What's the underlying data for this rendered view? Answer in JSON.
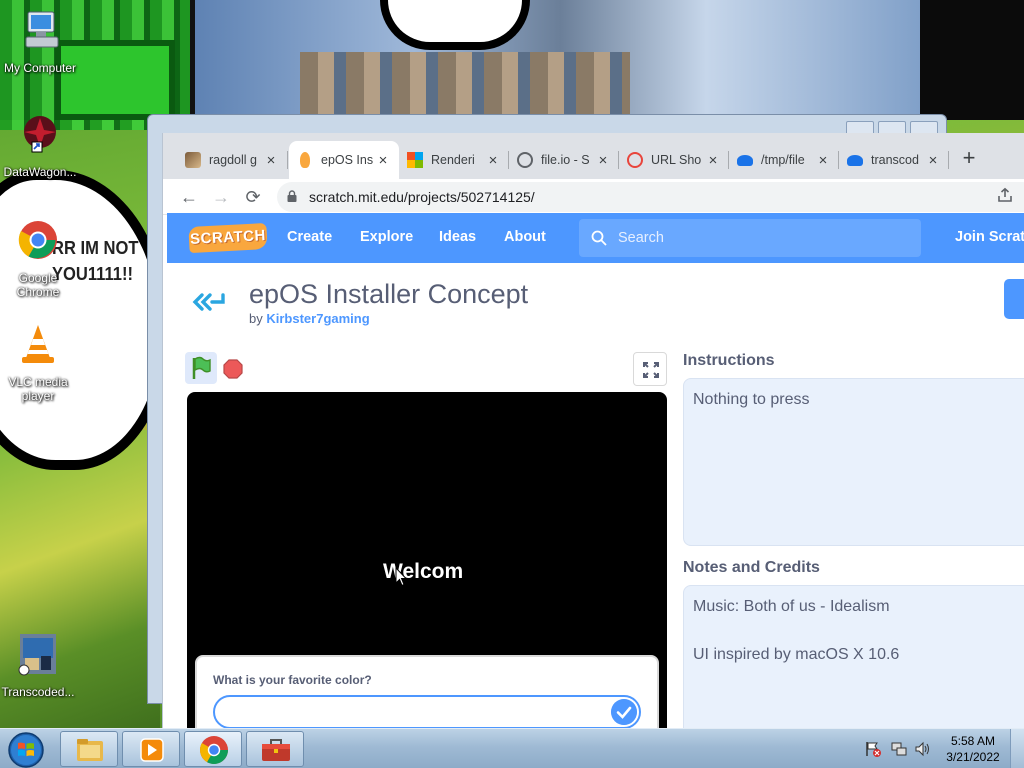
{
  "desktop": {
    "wallpaper_text": "RR IM NOT\nYOU1111!!",
    "icons": [
      {
        "label": "My Computer"
      },
      {
        "label": "DataWagon..."
      },
      {
        "label": "Google\nChrome"
      },
      {
        "label": "VLC media\nplayer"
      },
      {
        "label": "Transcoded..."
      }
    ]
  },
  "browser": {
    "tabs": [
      {
        "label": "ragdoll g",
        "close": "×"
      },
      {
        "label": "epOS Ins",
        "close": "×"
      },
      {
        "label": "Renderi",
        "close": "×"
      },
      {
        "label": "file.io - S",
        "close": "×"
      },
      {
        "label": "URL Sho",
        "close": "×"
      },
      {
        "label": "/tmp/file",
        "close": "×"
      },
      {
        "label": "transcod",
        "close": "×"
      }
    ],
    "new_tab": "+",
    "url": "scratch.mit.edu/projects/502714125/"
  },
  "scratch": {
    "logo": "SCRATCH",
    "nav": {
      "create": "Create",
      "explore": "Explore",
      "ideas": "Ideas",
      "about": "About"
    },
    "search_placeholder": "Search",
    "join": "Join Scratch",
    "project": {
      "title": "epOS Installer Concept",
      "by": "by",
      "author": "Kirbster7gaming"
    },
    "stage": {
      "text": "Welcom",
      "ask_question": "What is your favorite color?",
      "ask_value": ""
    },
    "instructions": {
      "heading": "Instructions",
      "text": "Nothing to press"
    },
    "notes": {
      "heading": "Notes and Credits",
      "line1": "Music: Both of us - Idealism",
      "line2": "UI inspired by macOS X 10.6"
    },
    "colors": {
      "accent": "#4d97ff",
      "text": "#575e75"
    }
  },
  "taskbar": {
    "time": "5:58 AM",
    "date": "3/21/2022"
  }
}
